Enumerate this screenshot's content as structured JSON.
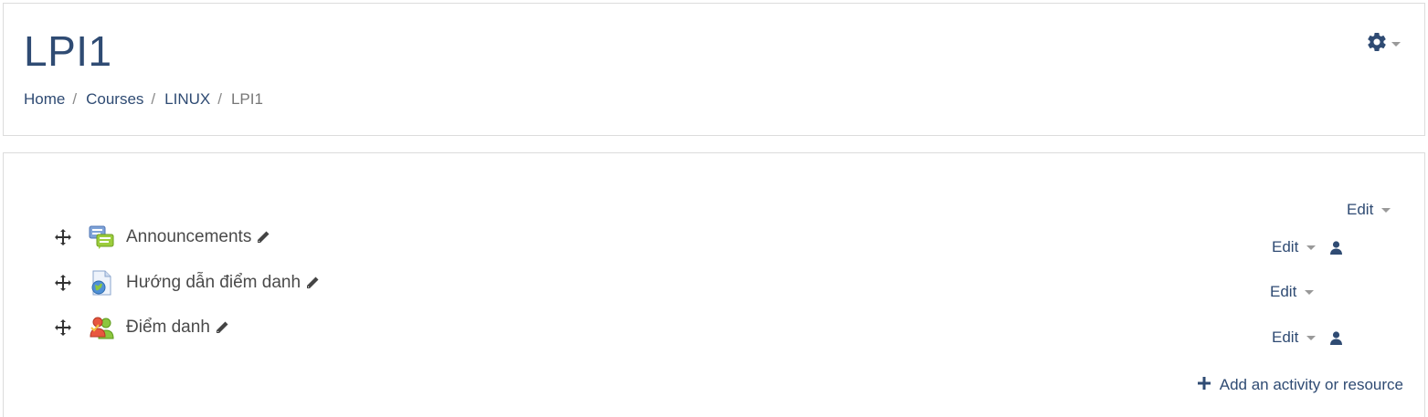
{
  "header": {
    "title": "LPI1",
    "breadcrumb": [
      {
        "label": "Home"
      },
      {
        "label": "Courses"
      },
      {
        "label": "LINUX"
      },
      {
        "label": "LPI1"
      }
    ],
    "settings_icon": "gear-icon"
  },
  "section": {
    "edit_label": "Edit"
  },
  "activities": [
    {
      "name": "Announcements",
      "icon": "forum-icon",
      "edit_label": "Edit",
      "has_group_icon": true
    },
    {
      "name": "Hướng dẫn điểm danh",
      "icon": "url-page-icon",
      "edit_label": "Edit",
      "has_group_icon": false
    },
    {
      "name": "Điểm danh",
      "icon": "attendance-icon",
      "edit_label": "Edit",
      "has_group_icon": true
    }
  ],
  "add_activity_label": "Add an activity or resource",
  "colors": {
    "link": "#2f4b73",
    "muted": "#777777",
    "border": "#dcdcdc"
  }
}
